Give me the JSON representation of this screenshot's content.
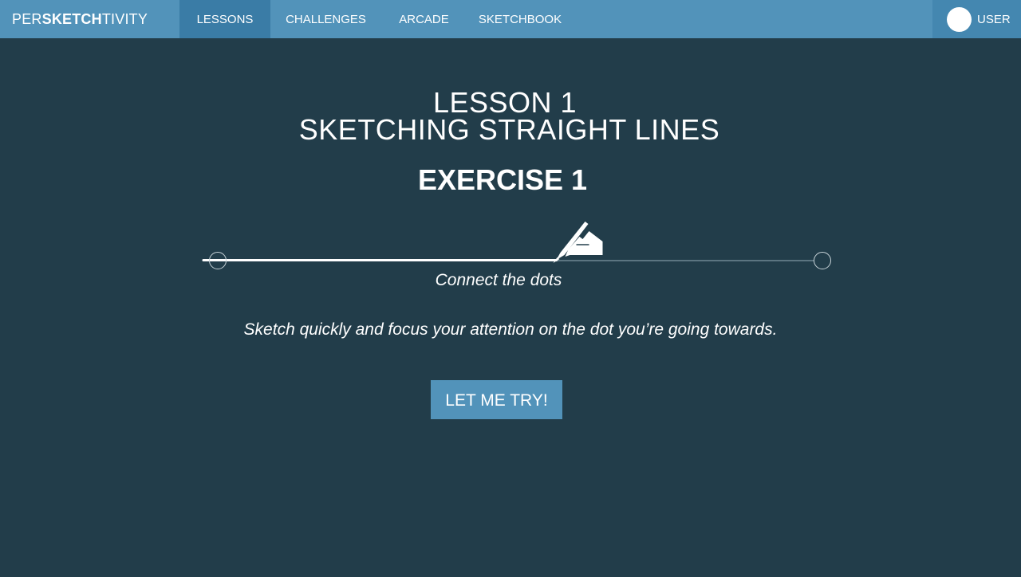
{
  "app": {
    "logo_prefix": "PER",
    "logo_strong": "SKETCH",
    "logo_suffix": "TIVITY"
  },
  "nav": {
    "items": [
      {
        "label": "LESSONS",
        "active": true
      },
      {
        "label": "CHALLENGES",
        "active": false
      },
      {
        "label": "ARCADE",
        "active": false
      },
      {
        "label": "SKETCHBOOK",
        "active": false
      }
    ],
    "user_label": "USER"
  },
  "lesson": {
    "line1": "LESSON 1",
    "line2": "SKETCHING STRAIGHT LINES",
    "exercise": "EXERCISE 1"
  },
  "demo": {
    "progress": 0.56,
    "icon": "hand-pen-icon"
  },
  "caption": "Connect the dots",
  "tip": "Sketch quickly and focus your attention on the dot you’re going towards.",
  "action": {
    "button_label": "LET ME TRY!"
  },
  "colors": {
    "background": "#223d4a",
    "header": "#5293ba",
    "active_nav": "#3a7ca6",
    "user_area": "#4487b0",
    "button": "#5293ba"
  }
}
